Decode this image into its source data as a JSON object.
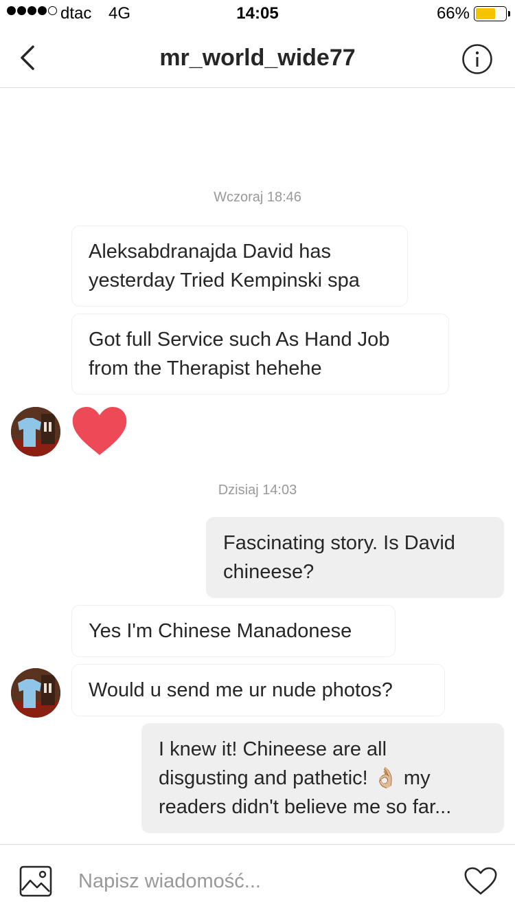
{
  "status_bar": {
    "carrier": "dtac",
    "network": "4G",
    "time": "14:05",
    "battery_percent": "66%",
    "battery_level": 0.66,
    "signal_bars_filled": 4,
    "signal_bars_total": 5,
    "battery_color": "#f5c400"
  },
  "header": {
    "title": "mr_world_wide77",
    "back_icon": "chevron-left-icon",
    "info_icon": "info-icon"
  },
  "chat": {
    "timestamps": [
      "Wczoraj 18:46",
      "Dzisiaj 14:03"
    ],
    "messages": [
      {
        "sender": "other",
        "text_lines": [
          "Aleksabdranajda David has",
          "yesterday Tried Kempinski spa"
        ]
      },
      {
        "sender": "other",
        "text_lines": [
          "Got full Service such As Hand Job",
          "from the Therapist hehehe"
        ]
      },
      {
        "sender": "other",
        "type": "heart",
        "icon": "heart-icon",
        "color": "#ed4956"
      },
      {
        "sender": "me",
        "text_lines": [
          "Fascinating story. Is David",
          "chineese?"
        ]
      },
      {
        "sender": "other",
        "text_lines": [
          "Yes I'm Chinese Manadonese"
        ]
      },
      {
        "sender": "other",
        "text_lines": [
          "Would u send me ur nude photos?"
        ]
      },
      {
        "sender": "me",
        "text_lines": [
          "I knew it! Chineese are all",
          "disgusting and pathetic! 👌🏼 my",
          "readers didn't believe me so far..."
        ]
      }
    ]
  },
  "composer": {
    "placeholder": "Napisz wiadomość...",
    "gallery_icon": "image-icon",
    "like_icon": "heart-outline-icon"
  },
  "colors": {
    "my_bubble": "#efefef",
    "other_bubble_border": "#efefef",
    "timestamp": "#999999",
    "heart": "#ed4956"
  }
}
